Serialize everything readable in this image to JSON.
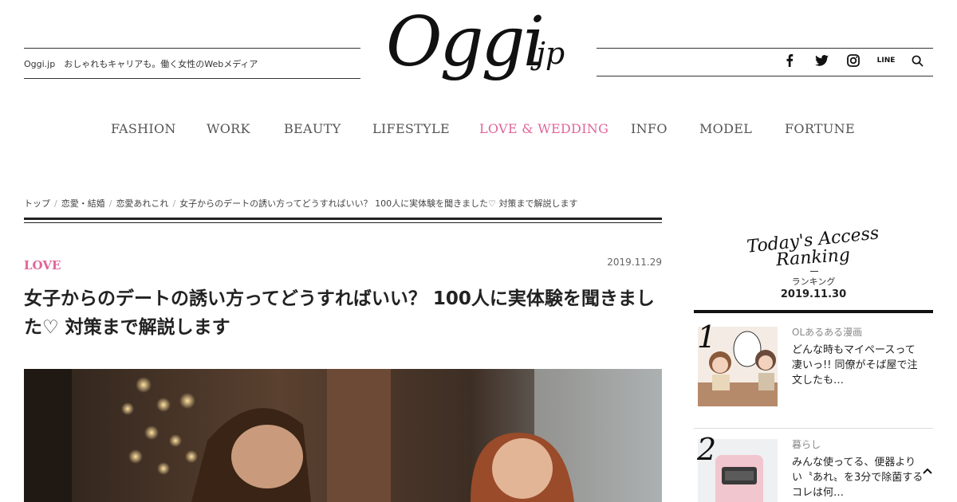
{
  "header": {
    "tagline": "Oggi.jp　おしゃれもキャリアも。働く女性のWebメディア",
    "logo_main": "Oggi",
    "logo_suffix": ".jp",
    "social": [
      {
        "name": "facebook-icon"
      },
      {
        "name": "twitter-icon"
      },
      {
        "name": "instagram-icon"
      },
      {
        "name": "line-icon",
        "label": "LINE"
      },
      {
        "name": "search-icon"
      }
    ]
  },
  "nav": {
    "items": [
      {
        "label": "FASHION",
        "active": false
      },
      {
        "label": "WORK",
        "active": false
      },
      {
        "label": "BEAUTY",
        "active": false
      },
      {
        "label": "LIFESTYLE",
        "active": false
      },
      {
        "label": "LOVE & WEDDING",
        "active": true
      },
      {
        "label": "INFO",
        "active": false
      },
      {
        "label": "MODEL",
        "active": false
      },
      {
        "label": "FORTUNE",
        "active": false
      }
    ]
  },
  "breadcrumb": {
    "items": [
      "トップ",
      "恋愛・結婚",
      "恋愛あれこれ",
      "女子からのデートの誘い方ってどうすればいい？ 100人に実体験を聞きました♡ 対策まで解説します"
    ]
  },
  "article": {
    "category": "LOVE",
    "date": "2019.11.29",
    "title": "女子からのデートの誘い方ってどうすればいい？ 100人に実体験を聞きました♡ 対策まで解説します"
  },
  "ranking": {
    "script_title_1": "Today's Access",
    "script_title_2": "Ranking",
    "subtitle": "ランキング",
    "date": "2019.11.30",
    "items": [
      {
        "rank": "1",
        "category": "OLあるある漫画",
        "text": "どんな時もマイペースって凄いっ!! 同僚がそば屋で注文したも…"
      },
      {
        "rank": "2",
        "category": "暮らし",
        "text": "みんな使ってる、便器よりい〝あれ〟を3分で除菌するコレは何…"
      }
    ]
  },
  "colors": {
    "accent": "#e0659a",
    "text": "#222222",
    "line": "#333333"
  }
}
